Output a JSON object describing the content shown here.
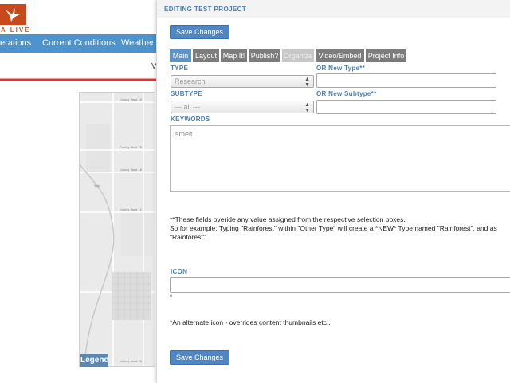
{
  "site": {
    "logo_text": "A LIVE",
    "nav": [
      "erations",
      "Current Conditions",
      "Weather a"
    ],
    "partial_letter": "V"
  },
  "map": {
    "road_labels": [
      "County Road 20",
      "County Road 18",
      "County Road 16",
      "County Road 12",
      "Yolo",
      "County Road 98"
    ],
    "legend_label": "Legend"
  },
  "colors": {
    "nav_bg": "#4d93cd",
    "accent": "#4a7fb5",
    "button": "#4f86c6",
    "tab_active": "#5e95c8",
    "tab_inactive": "#7d7d7d",
    "arrow": "#e2343a"
  },
  "panel": {
    "title": "EDITING TEST PROJECT",
    "save_top": "Save Changes",
    "save_bottom": "Save Changes",
    "tabs": [
      {
        "label": "Main",
        "state": "active"
      },
      {
        "label": "Layout",
        "state": "normal"
      },
      {
        "label": "Map It!",
        "state": "normal"
      },
      {
        "label": "Publish?",
        "state": "normal"
      },
      {
        "label": "Organize",
        "state": "dim"
      },
      {
        "label": "Video/Embed",
        "state": "normal"
      },
      {
        "label": "Project Info",
        "state": "normal"
      }
    ],
    "type_label": "TYPE",
    "type_value": "Research",
    "new_type_label": "OR New Type**",
    "subtype_label": "SUBTYPE",
    "subtype_value": "--- all ---",
    "new_subtype_label": "OR New Subtype**",
    "keywords_label": "KEYWORDS",
    "keywords_value": "smelt",
    "note1": "**These fields overide any value assigned from the respective selection boxes.",
    "note2": "So for example: Typing \"Rainforest\" within \"Other Type\" will create a *NEW* Type named \"Rainforest\", and as",
    "note3": "\"Rainforest\".",
    "icon_label": "ICON",
    "icon_marker": "*",
    "icon_note": "*An alternate icon - overrides content thumbnails etc.."
  }
}
